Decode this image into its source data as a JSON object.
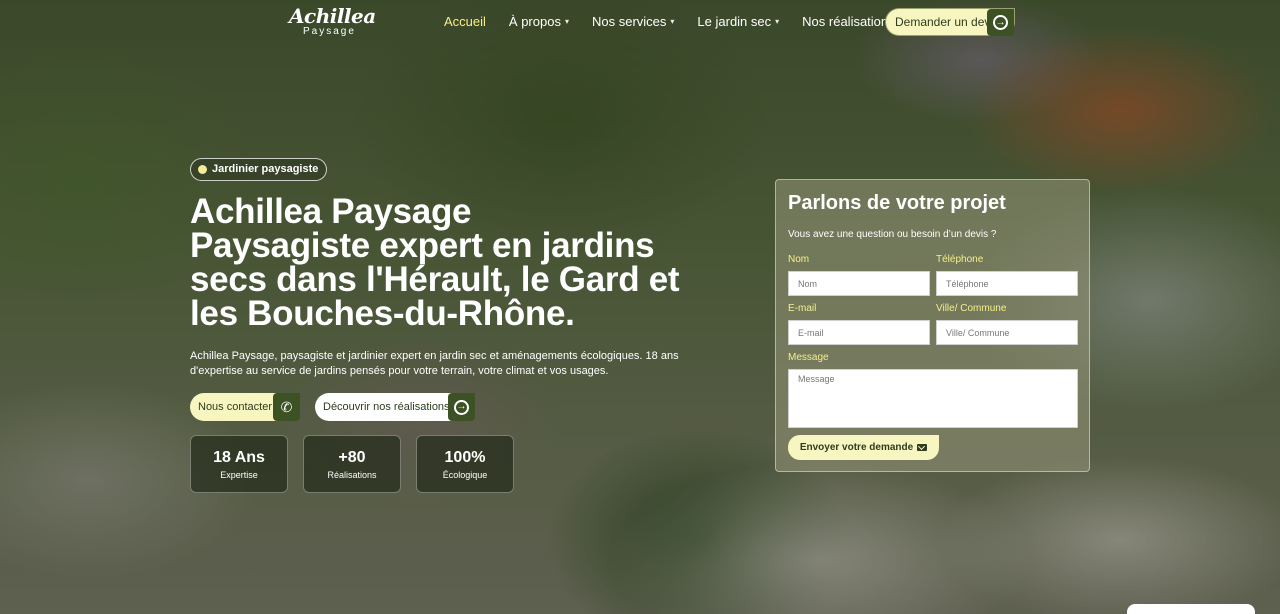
{
  "header": {
    "logo_script": "Achillea",
    "logo_sub": "Paysage",
    "nav": [
      {
        "label": "Accueil"
      },
      {
        "label": "À propos"
      },
      {
        "label": "Nos services"
      },
      {
        "label": "Le jardin sec"
      },
      {
        "label": "Nos réalisations"
      }
    ],
    "quote_button": "Demander un devis"
  },
  "hero": {
    "badge": "Jardinier paysagiste",
    "title_line1": "Achillea Paysage",
    "title_line2": "Paysagiste expert en jardins secs dans l'Hérault, le Gard et les Bouches-du-Rhône.",
    "description": "Achillea Paysage, paysagiste et jardinier expert en jardin sec et aménagements écologiques. 18 ans d'expertise au service de jardins pensés pour votre terrain, votre climat et vos usages.",
    "contact_button": "Nous contacter",
    "realisations_button": "Découvrir nos réalisations",
    "stats": [
      {
        "value": "18 Ans",
        "label": "Expertise"
      },
      {
        "value": "+80",
        "label": "Réalisations"
      },
      {
        "value": "100%",
        "label": "Écologique"
      }
    ]
  },
  "form": {
    "title": "Parlons de votre projet",
    "intro": "Vous avez une question ou besoin d’un devis ?",
    "name_label": "Nom",
    "name_placeholder": "Nom",
    "phone_label": "Téléphone",
    "phone_placeholder": "Téléphone",
    "email_label": "E-mail",
    "email_placeholder": "E-mail",
    "city_label": "Ville/ Commune",
    "city_placeholder": "Ville/ Commune",
    "message_label": "Message",
    "message_placeholder": "Message",
    "submit": "Envoyer votre demande"
  },
  "colors": {
    "accent_yellow": "#f6ef8a",
    "button_cream": "#f7f5c0",
    "dark_green": "#3c5224"
  }
}
